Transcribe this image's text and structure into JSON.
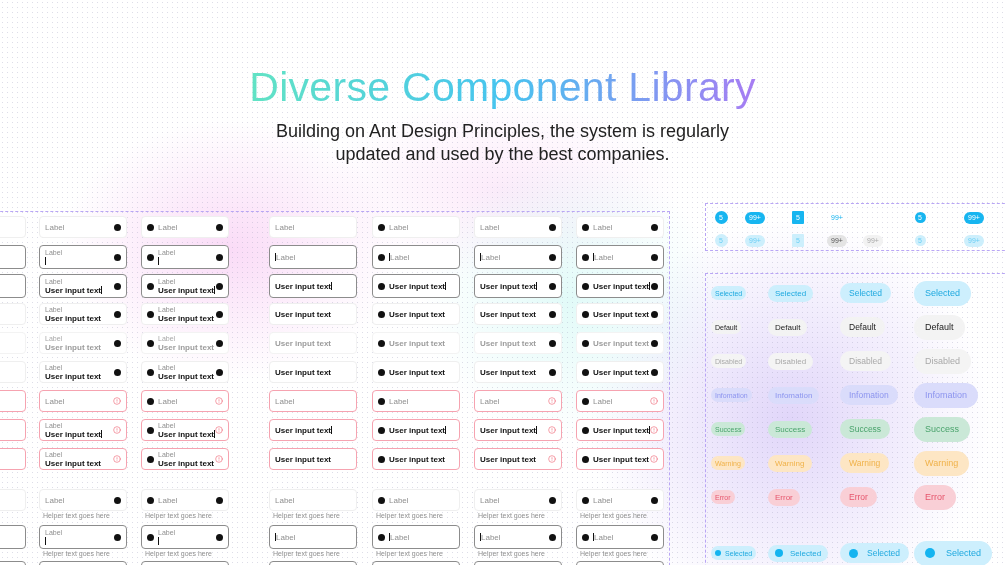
{
  "header": {
    "title": "Diverse Component Library",
    "subtitle": "Building on Ant Design Principles, the system is regularly updated and used by the best companies."
  },
  "inputs": {
    "partial_column": true,
    "cut_row": true,
    "columns": [
      {
        "floating_label": true,
        "leading_dot": false,
        "trailing_dot": true
      },
      {
        "floating_label": true,
        "leading_dot": true,
        "trailing_dot": true
      },
      {
        "floating_label": false,
        "leading_dot": false,
        "trailing_dot": false
      },
      {
        "floating_label": false,
        "leading_dot": true,
        "trailing_dot": false
      },
      {
        "floating_label": false,
        "leading_dot": false,
        "trailing_dot": true
      },
      {
        "floating_label": false,
        "leading_dot": true,
        "trailing_dot": true
      }
    ],
    "rows": [
      {
        "kind": "default",
        "cells": [
          {
            "label": "Label"
          },
          {
            "label": "Label"
          },
          {
            "label": "Label"
          },
          {
            "label": "Label"
          },
          {
            "label": "Label"
          },
          {
            "label": "Label"
          }
        ]
      },
      {
        "kind": "focus",
        "cells": [
          {
            "label": "Label",
            "cursor": true
          },
          {
            "label": "Label",
            "cursor": true
          },
          {
            "label": "Label",
            "cursor": true
          },
          {
            "label": "Label",
            "cursor": true
          },
          {
            "label": "Label",
            "cursor": true
          },
          {
            "label": "Label",
            "cursor": true
          }
        ]
      },
      {
        "kind": "focus",
        "cells": [
          {
            "label": "Label",
            "value": "User input text",
            "cursor": true
          },
          {
            "label": "Label",
            "value": "User input text",
            "cursor": true
          },
          {
            "value": "User input text",
            "cursor": true
          },
          {
            "value": "User input text",
            "cursor": true
          },
          {
            "value": "User input text",
            "cursor": true
          },
          {
            "value": "User input text",
            "cursor": true
          }
        ]
      },
      {
        "kind": "filled",
        "cells": [
          {
            "label": "Label",
            "value": "User input text"
          },
          {
            "label": "Label",
            "value": "User input text"
          },
          {
            "value": "User input text"
          },
          {
            "value": "User input text"
          },
          {
            "value": "User input text"
          },
          {
            "value": "User input text"
          }
        ]
      },
      {
        "kind": "disabled",
        "cells": [
          {
            "label": "Label",
            "value": "User input text"
          },
          {
            "label": "Label",
            "value": "User input text"
          },
          {
            "value": "User input text"
          },
          {
            "value": "User input text"
          },
          {
            "value": "User input text"
          },
          {
            "value": "User input text"
          }
        ]
      },
      {
        "kind": "filled",
        "cells": [
          {
            "label": "Label",
            "value": "User input text"
          },
          {
            "label": "Label",
            "value": "User input text"
          },
          {
            "value": "User input text"
          },
          {
            "value": "User input text"
          },
          {
            "value": "User input text"
          },
          {
            "value": "User input text"
          }
        ]
      },
      {
        "kind": "error",
        "cells": [
          {
            "label": "Label"
          },
          {
            "label": "Label"
          },
          {
            "label": "Label"
          },
          {
            "label": "Label"
          },
          {
            "label": "Label"
          },
          {
            "label": "Label"
          }
        ]
      },
      {
        "kind": "error",
        "cells": [
          {
            "label": "Label",
            "value": "User input text",
            "cursor": true
          },
          {
            "label": "Label",
            "value": "User input text",
            "cursor": true
          },
          {
            "value": "User input text",
            "cursor": true
          },
          {
            "value": "User input text",
            "cursor": true
          },
          {
            "value": "User input text",
            "cursor": true
          },
          {
            "value": "User input text",
            "cursor": true
          }
        ]
      },
      {
        "kind": "error",
        "cells": [
          {
            "label": "Label",
            "value": "User input text"
          },
          {
            "label": "Label",
            "value": "User input text"
          },
          {
            "value": "User input text"
          },
          {
            "value": "User input text"
          },
          {
            "value": "User input text"
          },
          {
            "value": "User input text"
          }
        ]
      },
      {
        "kind": "default",
        "cells": [
          {
            "label": "Label",
            "helper": "Helper text goes here"
          },
          {
            "label": "Label",
            "helper": "Helper text goes here"
          },
          {
            "label": "Label",
            "helper": "Helper text goes here"
          },
          {
            "label": "Label",
            "helper": "Helper text goes here"
          },
          {
            "label": "Label",
            "helper": "Helper text goes here"
          },
          {
            "label": "Label",
            "helper": "Helper text goes here"
          }
        ]
      },
      {
        "kind": "focus",
        "cells": [
          {
            "label": "Label",
            "cursor": true,
            "helper": "Helper text goes here"
          },
          {
            "label": "Label",
            "cursor": true,
            "helper": "Helper text goes here"
          },
          {
            "label": "Label",
            "cursor": true,
            "helper": "Helper text goes here"
          },
          {
            "label": "Label",
            "cursor": true,
            "helper": "Helper text goes here"
          },
          {
            "label": "Label",
            "cursor": true,
            "helper": "Helper text goes here"
          },
          {
            "label": "Label",
            "cursor": true,
            "helper": "Helper text goes here"
          }
        ]
      }
    ]
  },
  "badges": {
    "rows": [
      {
        "items": [
          {
            "kind": "solid-circle",
            "text": "5"
          },
          {
            "kind": "solid-pill",
            "text": "99+"
          },
          {
            "kind": "solid-square",
            "text": "5"
          },
          {
            "kind": "solid-plain",
            "text": "99+"
          },
          {
            "kind": "solid-small",
            "text": "5"
          },
          {
            "kind": "solid-pill",
            "text": "99+"
          }
        ]
      },
      {
        "items": [
          {
            "kind": "light-circle",
            "text": "5"
          },
          {
            "kind": "light-pill",
            "text": "99+"
          },
          {
            "kind": "light-square",
            "text": "5"
          },
          {
            "kind": "grey-pill",
            "text": "99+"
          },
          {
            "kind": "faint-pill",
            "text": "99+"
          },
          {
            "kind": "light-small",
            "text": "5"
          },
          {
            "kind": "light-pill",
            "text": "99+"
          }
        ]
      }
    ]
  },
  "tags": {
    "rows": [
      {
        "kind": "selected",
        "dot": false,
        "labels": [
          "Selected",
          "Selected",
          "Selected",
          "Selected"
        ]
      },
      {
        "kind": "default",
        "dot": false,
        "labels": [
          "Default",
          "Default",
          "Default",
          "Default"
        ]
      },
      {
        "kind": "disabled",
        "dot": false,
        "labels": [
          "Disabled",
          "Disabled",
          "Disabled",
          "Disabled"
        ]
      },
      {
        "kind": "info",
        "dot": false,
        "labels": [
          "Infomation",
          "Infomation",
          "Infomation",
          "Infomation"
        ]
      },
      {
        "kind": "success",
        "dot": false,
        "labels": [
          "Success",
          "Success",
          "Success",
          "Success"
        ]
      },
      {
        "kind": "warning",
        "dot": false,
        "labels": [
          "Warning",
          "Warning",
          "Warning",
          "Warning"
        ]
      },
      {
        "kind": "error",
        "dot": false,
        "labels": [
          "Error",
          "Error",
          "Error",
          "Error"
        ]
      },
      {
        "kind": "selected",
        "dot": true,
        "labels": [
          "Selected",
          "Selected",
          "Selected",
          "Selected"
        ]
      }
    ]
  }
}
